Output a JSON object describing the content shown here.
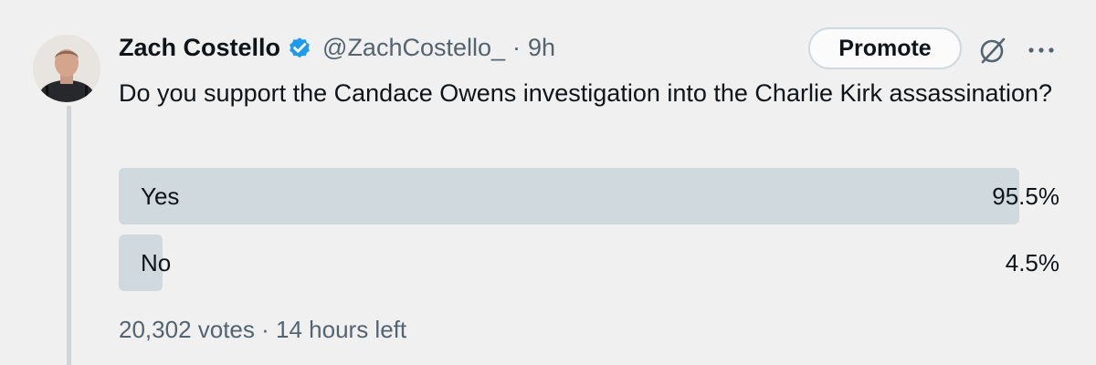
{
  "author": {
    "name": "Zach Costello",
    "handle": "@ZachCostello_",
    "separator": "·",
    "time": "9h",
    "verified_color": "#1d9bf0"
  },
  "actions": {
    "promote_label": "Promote",
    "grok_icon": "grok-icon",
    "more_icon": "more-icon"
  },
  "tweet": {
    "text": "Do you support the Candace Owens investigation into the Charlie Kirk assassination?"
  },
  "poll": {
    "options": [
      {
        "label": "Yes",
        "percent": "95.5%",
        "fraction": 0.955
      },
      {
        "label": "No",
        "percent": "4.5%",
        "fraction": 0.045
      }
    ],
    "votes": "20,302 votes",
    "separator": "·",
    "time_left": "14 hours left",
    "bar_color": "#cfd9de"
  }
}
